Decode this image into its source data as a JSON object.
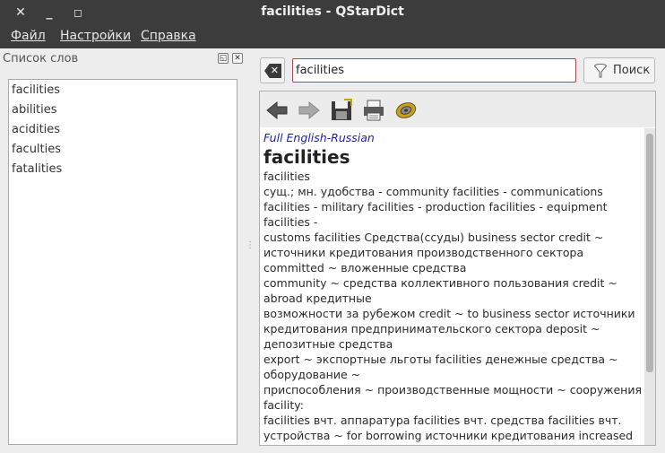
{
  "window": {
    "title": "facilities - QStarDict",
    "close_glyph": "✕",
    "minimize_glyph": "_",
    "maximize_glyph": "◻"
  },
  "menu": [
    {
      "label": "Файл"
    },
    {
      "label": "Настройки"
    },
    {
      "label": "Справка"
    }
  ],
  "sidebar": {
    "title": "Список слов",
    "float_glyph": "◱",
    "close_glyph": "✕",
    "words": [
      "facilities",
      "abilities",
      "acidities",
      "faculties",
      "fatalities"
    ]
  },
  "search": {
    "value": "facilities",
    "button_label": "Поиск"
  },
  "toolbar": {
    "back_icon": "arrow-left-icon",
    "forward_icon": "arrow-right-icon",
    "save_icon": "floppy-disk-icon",
    "print_icon": "printer-icon",
    "speak_icon": "speaker-icon"
  },
  "article": {
    "dictionary": "Full English-Russian",
    "headword": "facilities",
    "lines": [
      "facilities",
      "сущ.; мн. удобства - community facilities - communications facilities - military facilities - production facilities - equipment facilities -",
      "customs facilities Средства(ссуды) business sector credit ~ источники кредитования производственного сектора committed ~ вложенные средства",
      "community ~ средства коллективного пользования credit ~ abroad кредитные",
      "возможности за рубежом credit ~ to business sector источники кредитования предпринимательского сектора deposit ~ депозитные средства",
      "export ~ экспортные льготы facilities денежные средства ~ оборудование ~",
      "приспособления ~ производственные мощности ~ сооружения facility:",
      "facilities вчт. аппаратура facilities вчт. средства facilities вчт. устройства ~ for borrowing источники кредитования increased credit ~ увеличенные банковские кредиты production ~ производственное"
    ]
  },
  "colors": {
    "titlebar": "#3c3c3c",
    "dict_name": "#1b1bc4",
    "input_border": "#dd3333"
  }
}
